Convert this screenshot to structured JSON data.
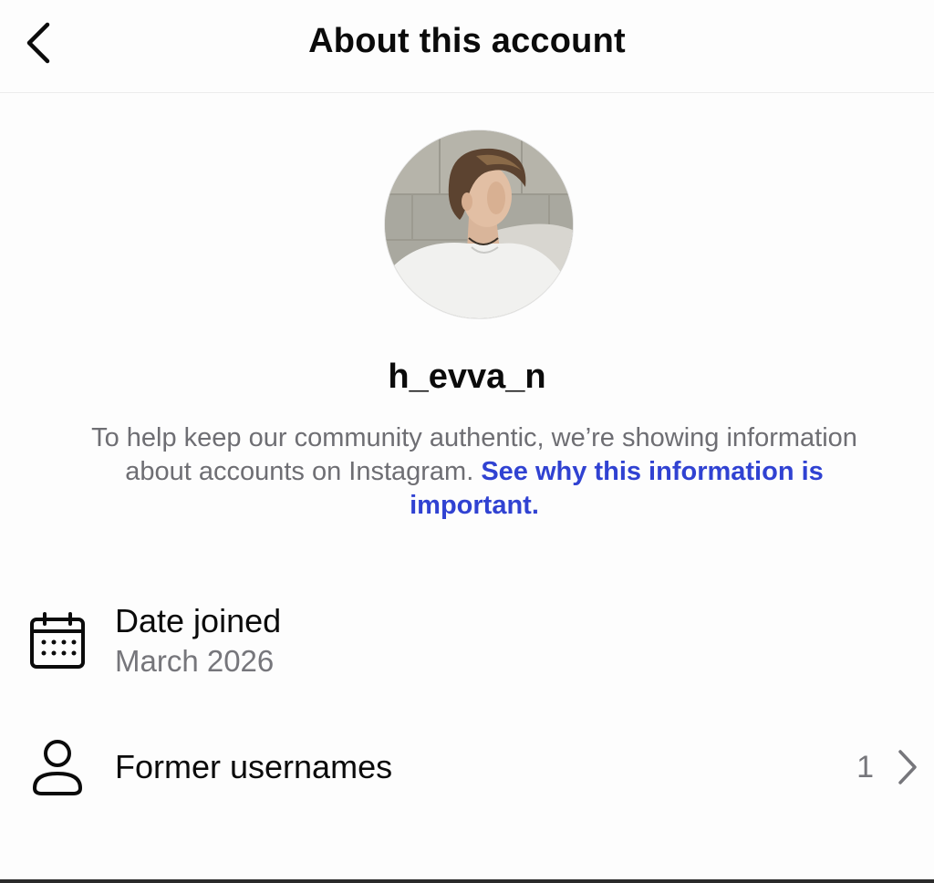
{
  "header": {
    "title": "About this account",
    "back_icon": "chevron-left-icon"
  },
  "profile": {
    "username": "h_evva_n",
    "avatar_icon": "profile-photo"
  },
  "info": {
    "text": "To help keep our community authentic, we’re showing information about accounts on Instagram.",
    "link_text": "See why this information is important."
  },
  "rows": {
    "date_joined": {
      "icon": "calendar-icon",
      "label": "Date joined",
      "value": "March 2026"
    },
    "former_usernames": {
      "icon": "person-icon",
      "label": "Former usernames",
      "count": "1",
      "chevron_icon": "chevron-right-icon"
    }
  },
  "colors": {
    "link": "#3042d2",
    "secondary_text": "#6e6e73",
    "primary_text": "#0b0b0b",
    "background": "#fdfdfd"
  }
}
